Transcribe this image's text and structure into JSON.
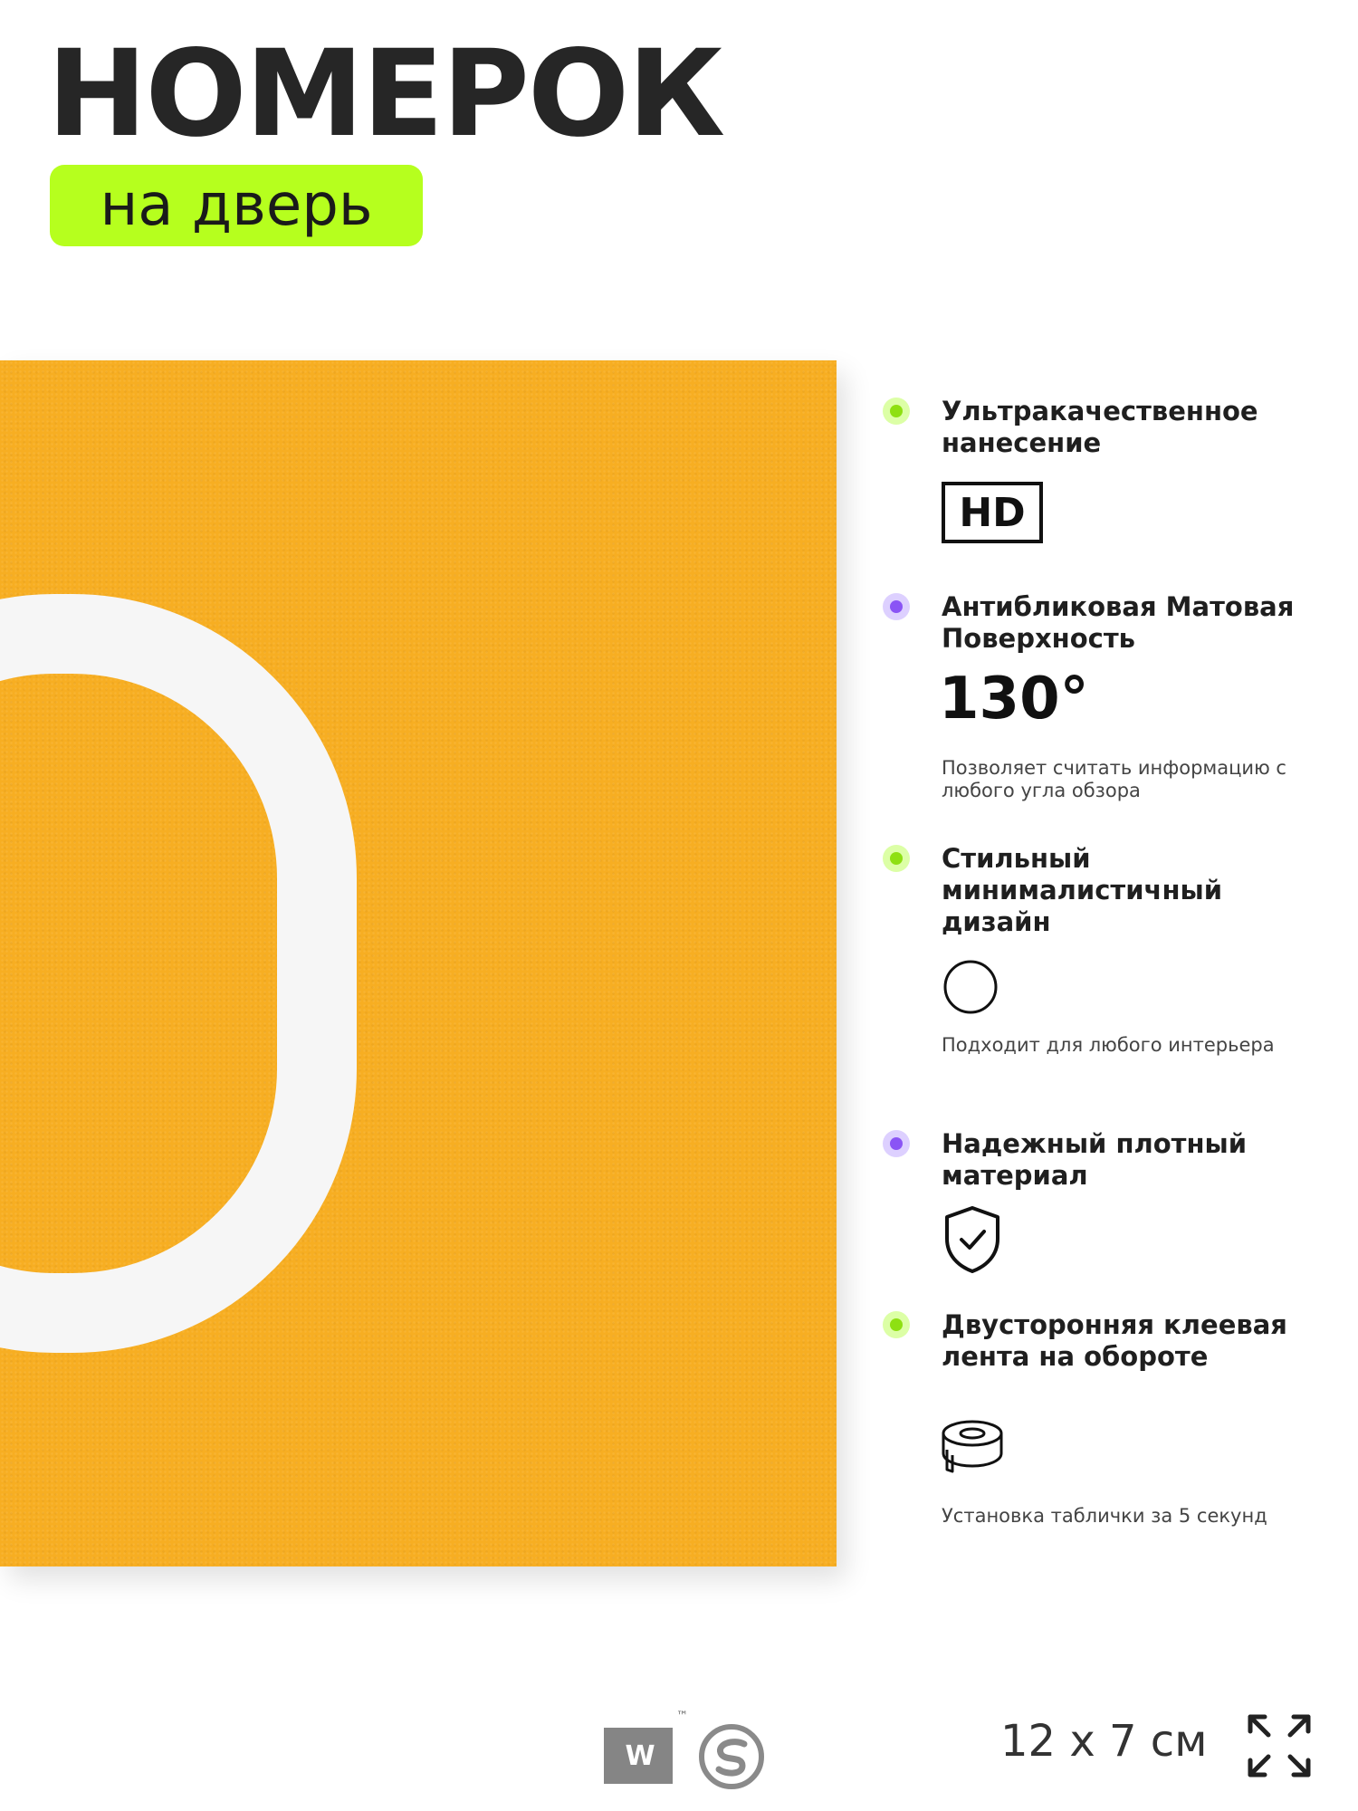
{
  "header": {
    "title": "НОМЕРОК",
    "subtitle": "на дверь"
  },
  "plate": {
    "color": "#f7ae22",
    "digit_color": "#ffffff",
    "digit_shape": "partial-zero-outline"
  },
  "features": [
    {
      "title": "Ультракачественное нанесение",
      "bullet": "green",
      "badge": "HD"
    },
    {
      "title": "Антибликовая Матовая Поверхность",
      "bullet": "violet",
      "value": "130°",
      "description": "Позволяет считать информацию с любого угла обзора"
    },
    {
      "title": "Стильный минималистичный дизайн",
      "bullet": "green",
      "icon": "circle-outline-icon",
      "description": "Подходит для любого интерьера"
    },
    {
      "title": "Надежный плотный материал",
      "bullet": "violet",
      "icon": "shield-check-icon"
    },
    {
      "title": "Двусторонняя клеевая лента на обороте",
      "bullet": "green",
      "icon": "tape-roll-icon",
      "description": "Установка таблички за 5 секунд"
    }
  ],
  "footer": {
    "logo_w": "W",
    "trademark": "™",
    "size": "12 x 7 см",
    "expand_icon": "expand-arrows-icon"
  },
  "colors": {
    "accent_green": "#b6ff1e",
    "bullet_green": "#8ee012",
    "bullet_violet": "#8a54f5"
  }
}
